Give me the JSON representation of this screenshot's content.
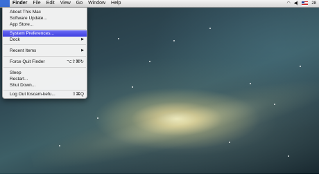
{
  "menubar": {
    "apple_glyph": "",
    "menus": [
      "Finder",
      "File",
      "Edit",
      "View",
      "Go",
      "Window",
      "Help"
    ],
    "status": {
      "wifi_icon": "wifi-icon",
      "volume_icon": "volume-icon",
      "flag_icon": "us-flag-icon",
      "time_fragment": "28"
    }
  },
  "apple_menu": {
    "items": [
      {
        "label": "About This Mac"
      },
      {
        "label": "Software Update..."
      },
      {
        "label": "App Store..."
      },
      {
        "label": "System Preferences...",
        "highlighted": true
      },
      {
        "label": "Dock",
        "submenu": true
      },
      {
        "label": "Recent Items",
        "submenu": true
      },
      {
        "label": "Force Quit Finder",
        "shortcut": "⌥⇧⌘↻"
      },
      {
        "label": "Sleep"
      },
      {
        "label": "Restart..."
      },
      {
        "label": "Shut Down..."
      },
      {
        "label": "Log Out foscam-kefu...",
        "shortcut": "⇧⌘Q"
      }
    ]
  },
  "colors": {
    "highlight": "#4a4ae8",
    "apple_menu_bg": "#3b6fd6"
  }
}
